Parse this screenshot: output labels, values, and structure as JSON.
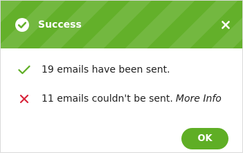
{
  "colors": {
    "header_bg": "#63b02a",
    "accent": "#5fae25",
    "success_check": "#5fae25",
    "error_x": "#d8253b"
  },
  "dialog": {
    "title": "Success",
    "header_icon": "check-circle-icon",
    "close_icon": "close-icon"
  },
  "messages": [
    {
      "icon": "checkmark-icon",
      "text": "19 emails have been sent."
    },
    {
      "icon": "x-mark-icon",
      "text": "11 emails couldn't be sent.",
      "link": "More Info"
    }
  ],
  "actions": {
    "ok_label": "OK"
  }
}
